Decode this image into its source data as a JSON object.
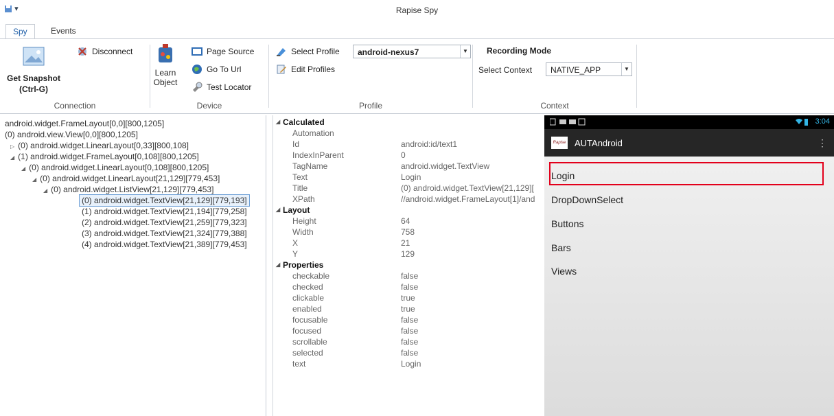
{
  "window": {
    "title": "Rapise Spy",
    "quick_access": "▾"
  },
  "tabs": [
    {
      "label": "Spy"
    },
    {
      "label": "Events"
    }
  ],
  "ribbon": {
    "connection": {
      "label": "Connection",
      "get_snapshot": "Get Snapshot",
      "shortcut": "(Ctrl-G)",
      "disconnect": "Disconnect"
    },
    "device": {
      "label": "Device",
      "learn": "Learn",
      "object": "Object",
      "page_source": "Page Source",
      "go_to_url": "Go To Url",
      "test_locator": "Test Locator"
    },
    "profile": {
      "label": "Profile",
      "select_profile": "Select Profile",
      "edit_profiles": "Edit Profiles",
      "profile_value": "android-nexus7"
    },
    "context": {
      "label": "Context",
      "recording_mode": "Recording Mode",
      "select_context": "Select Context",
      "context_value": "NATIVE_APP"
    }
  },
  "tree": [
    {
      "text": "android.widget.FrameLayout[0,0][800,1205]",
      "expander": ""
    },
    {
      "text": "(0) android.view.View[0,0][800,1205]",
      "expander": ""
    },
    {
      "text": "(0) android.widget.LinearLayout[0,33][800,108]",
      "expander": "▷"
    },
    {
      "text": "(1) android.widget.FrameLayout[0,108][800,1205]",
      "expander": "◢"
    },
    {
      "text": "(0) android.widget.LinearLayout[0,108][800,1205]",
      "expander": "◢"
    },
    {
      "text": "(0) android.widget.LinearLayout[21,129][779,453]",
      "expander": "◢"
    },
    {
      "text": "(0) android.widget.ListView[21,129][779,453]",
      "expander": "◢"
    },
    {
      "text": "(0) android.widget.TextView[21,129][779,193]",
      "expander": ""
    },
    {
      "text": "(1) android.widget.TextView[21,194][779,258]",
      "expander": ""
    },
    {
      "text": "(2) android.widget.TextView[21,259][779,323]",
      "expander": ""
    },
    {
      "text": "(3) android.widget.TextView[21,324][779,388]",
      "expander": ""
    },
    {
      "text": "(4) android.widget.TextView[21,389][779,453]",
      "expander": ""
    }
  ],
  "properties": [
    {
      "name": "Calculated",
      "value": "",
      "category": true
    },
    {
      "name": "Automation",
      "value": ""
    },
    {
      "name": "Id",
      "value": "android:id/text1"
    },
    {
      "name": "IndexInParent",
      "value": "0"
    },
    {
      "name": "TagName",
      "value": "android.widget.TextView"
    },
    {
      "name": "Text",
      "value": "Login"
    },
    {
      "name": "Title",
      "value": "(0) android.widget.TextView[21,129]["
    },
    {
      "name": "XPath",
      "value": "//android.widget.FrameLayout[1]/and"
    },
    {
      "name": "Layout",
      "value": "",
      "category": true
    },
    {
      "name": "Height",
      "value": "64"
    },
    {
      "name": "Width",
      "value": "758"
    },
    {
      "name": "X",
      "value": "21"
    },
    {
      "name": "Y",
      "value": "129"
    },
    {
      "name": "Properties",
      "value": "",
      "category": true
    },
    {
      "name": "checkable",
      "value": "false"
    },
    {
      "name": "checked",
      "value": "false"
    },
    {
      "name": "clickable",
      "value": "true"
    },
    {
      "name": "enabled",
      "value": "true"
    },
    {
      "name": "focusable",
      "value": "false"
    },
    {
      "name": "focused",
      "value": "false"
    },
    {
      "name": "scrollable",
      "value": "false"
    },
    {
      "name": "selected",
      "value": "false"
    },
    {
      "name": "text",
      "value": "Login"
    }
  ],
  "device": {
    "time": "3:04",
    "app_title": "AUTAndroid",
    "logo_text": "Rapise",
    "items": [
      "Login",
      "DropDownSelect",
      "Buttons",
      "Bars",
      "Views"
    ],
    "colors": {
      "highlight": "#e3001b",
      "status_icon": "#33b5e5"
    }
  }
}
